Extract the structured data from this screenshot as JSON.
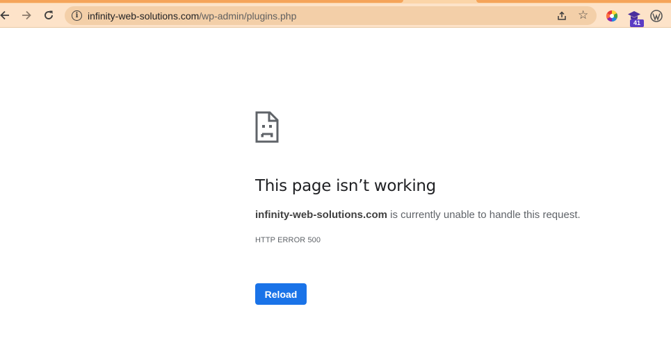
{
  "browser": {
    "url_host": "infinity-web-solutions.com",
    "url_path": "/wp-admin/plugins.php",
    "nav_back_icon": "arrow-left-icon",
    "nav_forward_icon": "arrow-right-icon",
    "nav_reload_icon": "reload-icon",
    "extension_badge": "41",
    "colors": {
      "toolbar": "#fde3c9",
      "omnibox": "#f3cfa8",
      "tab_accent": "#f5a45a"
    }
  },
  "error_page": {
    "icon": "sad-page-icon",
    "heading": "This page isn’t working",
    "host": "infinity-web-solutions.com",
    "message_rest": " is currently unable to handle this request.",
    "error_code": "HTTP ERROR 500",
    "reload_label": "Reload",
    "button_color": "#1a73e8"
  }
}
